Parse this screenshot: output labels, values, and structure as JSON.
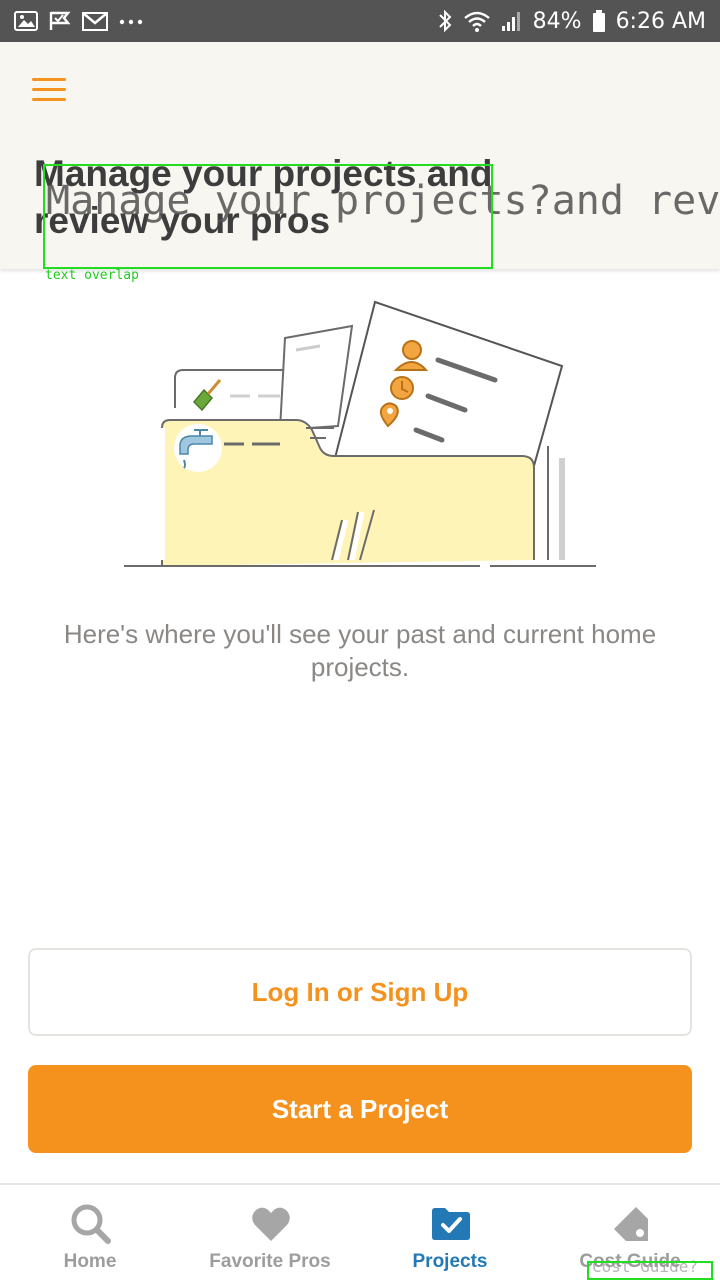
{
  "status_bar": {
    "battery": "84%",
    "time": "6:26 AM",
    "icons": [
      "image-icon",
      "checkmark-flag-icon",
      "gmail-icon",
      "more-icon",
      "bluetooth-icon",
      "wifi-icon",
      "signal-icon",
      "battery-icon"
    ]
  },
  "header": {
    "menu_icon": "hamburger-menu-icon",
    "title": "Manage your projects and review your pros",
    "overlap_text": "Manage your projects?and review your pros",
    "overlap_label": "text overlap"
  },
  "illustration": {
    "icons": [
      "shovel-icon",
      "faucet-icon",
      "person-icon",
      "clock-icon",
      "location-pin-icon"
    ]
  },
  "main": {
    "empty_message": "Here's where you'll see your past and current home projects."
  },
  "actions": {
    "login_label": "Log In or Sign Up",
    "start_label": "Start a Project"
  },
  "colors": {
    "accent": "#f5921e",
    "active_nav": "#2379b5",
    "inactive_nav": "#9d9d9d",
    "header_bg": "#f8f6f1",
    "status_bar": "#545454"
  },
  "bottom_nav": {
    "items": [
      {
        "label": "Home",
        "icon": "search-icon",
        "active": false
      },
      {
        "label": "Favorite Pros",
        "icon": "heart-icon",
        "active": false
      },
      {
        "label": "Projects",
        "icon": "folder-check-icon",
        "active": true
      },
      {
        "label": "Cost Guide",
        "icon": "tag-icon",
        "active": false
      }
    ],
    "overlap_text": "Cost Guide?"
  }
}
